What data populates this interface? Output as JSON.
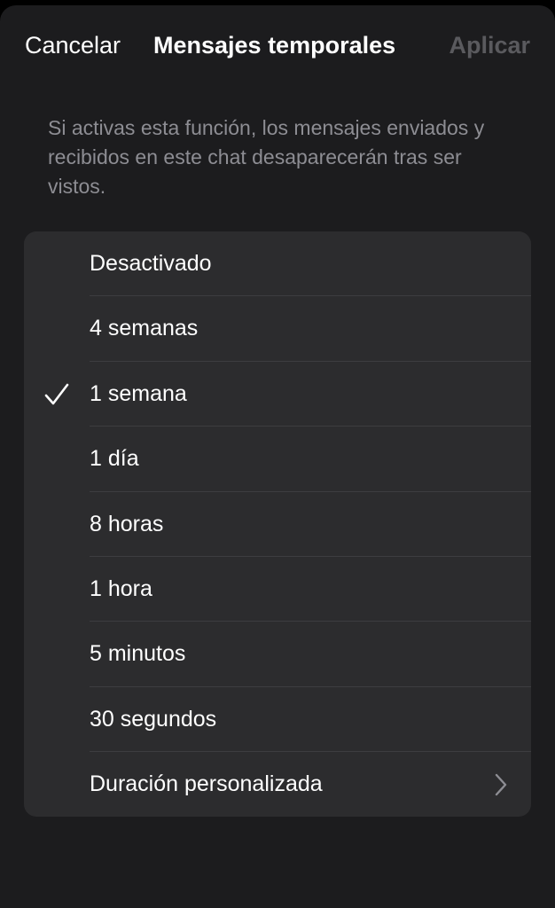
{
  "nav": {
    "cancel_label": "Cancelar",
    "title": "Mensajes temporales",
    "apply_label": "Aplicar"
  },
  "description": "Si activas esta función, los mensajes enviados y recibidos en este chat desaparecerán tras ser vistos.",
  "options": [
    {
      "label": "Desactivado",
      "selected": false
    },
    {
      "label": "4 semanas",
      "selected": false
    },
    {
      "label": "1 semana",
      "selected": true
    },
    {
      "label": "1 día",
      "selected": false
    },
    {
      "label": "8 horas",
      "selected": false
    },
    {
      "label": "1 hora",
      "selected": false
    },
    {
      "label": "5 minutos",
      "selected": false
    },
    {
      "label": "30 segundos",
      "selected": false
    },
    {
      "label": "Duración personalizada",
      "selected": false
    }
  ],
  "icons": {
    "selected": "checkmark-icon",
    "custom_duration": "chevron-right-icon"
  },
  "colors": {
    "background": "#1c1c1e",
    "list_background": "#2c2c2e",
    "text": "#ffffff",
    "secondary_text": "#8d8d93",
    "disabled_text": "#5a5a5e"
  }
}
